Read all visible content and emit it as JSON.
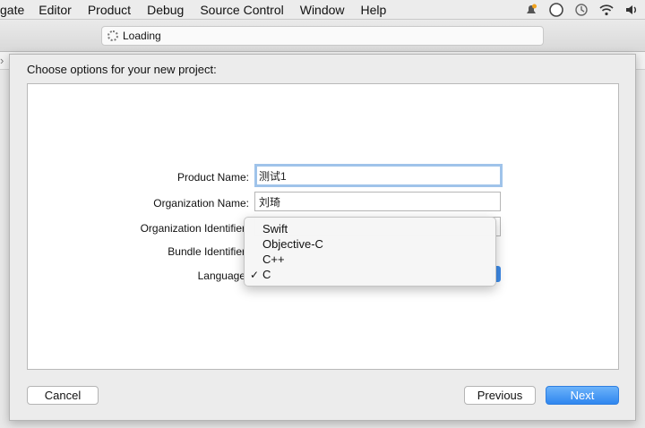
{
  "menubar": {
    "items": [
      "gate",
      "Editor",
      "Product",
      "Debug",
      "Source Control",
      "Window",
      "Help"
    ],
    "status_icons": [
      "notification-icon",
      "circle-icon",
      "time-machine-icon",
      "wifi-icon",
      "volume-icon"
    ]
  },
  "toolbar": {
    "activity_text": "Loading"
  },
  "sheet": {
    "title": "Choose options for your new project:",
    "fields": {
      "product_name": {
        "label": "Product Name:",
        "value": "测试1"
      },
      "organization_name": {
        "label": "Organization Name:",
        "value": "刘琦"
      },
      "organization_identifier": {
        "label": "Organization Identifier"
      },
      "bundle_identifier": {
        "label": "Bundle Identifier"
      },
      "language": {
        "label": "Language"
      }
    },
    "language_menu": {
      "options": [
        "Swift",
        "Objective-C",
        "C++",
        "C"
      ],
      "selected": "C",
      "check_glyph": "✓"
    },
    "buttons": {
      "cancel": "Cancel",
      "previous": "Previous",
      "next": "Next"
    }
  },
  "colors": {
    "accent": "#2f86ef",
    "focus_ring": "#9fc3ea"
  }
}
